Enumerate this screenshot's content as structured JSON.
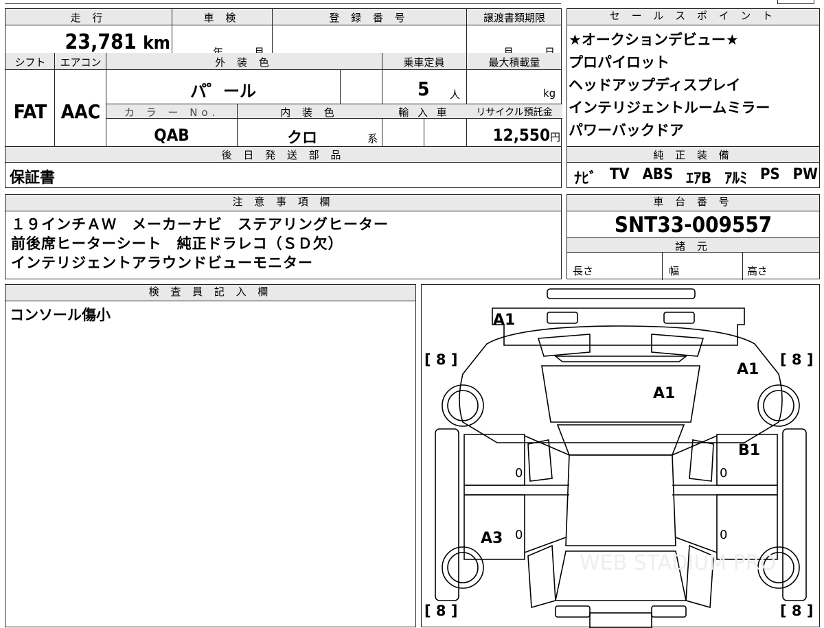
{
  "top_row": {
    "mileage_label": "走 行",
    "mileage_value": "23,781",
    "mileage_unit": "km",
    "inspection_label": "車 検",
    "inspection_year_unit": "年",
    "inspection_month_unit": "月",
    "registration_label": "登 録 番 号",
    "transfer_docs_label": "譲渡書類期限",
    "transfer_month_unit": "月",
    "transfer_day_unit": "日"
  },
  "mid_row": {
    "shift_label": "シフト",
    "shift_value": "FAT",
    "ac_label": "エアコン",
    "ac_value": "AAC",
    "exterior_color_label": "外 装 色",
    "exterior_color_value": "パ゜ール",
    "capacity_label": "乗車定員",
    "capacity_value": "5",
    "capacity_unit": "人",
    "max_load_label": "最大積載量",
    "max_load_unit": "kg",
    "color_no_label": "カ ラ ー No.",
    "color_no_value": "QAB",
    "interior_color_label": "内 装 色",
    "interior_color_value": "クロ",
    "interior_color_suffix": "系",
    "import_label": "輸 入 車",
    "recycle_label": "リサイクル預託金",
    "recycle_value": "12,550",
    "recycle_unit": "円"
  },
  "later_parts": {
    "label": "後 日 発 送 部 品",
    "value": "保証書"
  },
  "sales_points": {
    "label": "セ ー ル ス ポ イ ン ト",
    "items": [
      "★オークションデビュー★",
      "プロパイロット",
      "ヘッドアップディスプレイ",
      "インテリジェントルームミラー",
      "パワーバックドア"
    ]
  },
  "genuine_equipment": {
    "label": "純 正 装 備",
    "items": [
      "ﾅﾋﾞ",
      "TV",
      "ABS",
      "ｴｱB",
      "ｱﾙﾐ",
      "PS",
      "PW"
    ]
  },
  "notes": {
    "label": "注 意 事 項 欄",
    "lines": [
      "１９インチＡＷ　メーカーナビ　ステアリングヒーター",
      "前後席ヒーターシート　純正ドラレコ（ＳＤ欠）",
      "インテリジェントアラウンドビューモニター"
    ]
  },
  "chassis": {
    "label": "車 台 番 号",
    "value": "SNT33-009557"
  },
  "specs": {
    "label": "諸 元",
    "length_label": "長さ",
    "width_label": "幅",
    "height_label": "高さ"
  },
  "inspector": {
    "label": "検 査 員 記 入 欄",
    "comment": "コンソール傷小"
  },
  "diagram": {
    "tire_marks": [
      "[ 8 ]",
      "[ 8 ]",
      "[ 8 ]",
      "[ 8 ]"
    ],
    "damage_marks": [
      "A1",
      "A1",
      "A1",
      "B1",
      "A3"
    ],
    "zero_marks": [
      "0",
      "0",
      "0",
      "0"
    ],
    "watermark": "WEB STADIUM PRO"
  }
}
